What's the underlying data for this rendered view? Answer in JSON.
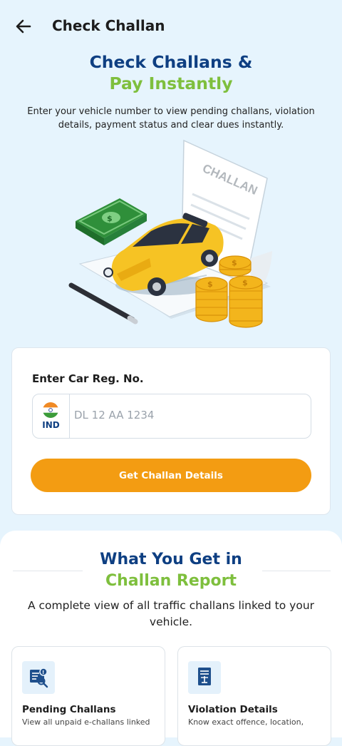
{
  "header": {
    "title": "Check Challan",
    "back_icon": "arrow-left-icon"
  },
  "hero": {
    "title_line1": "Check Challans &",
    "title_line2": "Pay Instantly",
    "description": "Enter your vehicle number to view pending challans, violation details, payment status and clear dues instantly.",
    "illustration_document_text": "CHALLAN"
  },
  "form": {
    "label": "Enter Car Reg. No.",
    "country_code": "IND",
    "flag_icon": "india-flag-icon",
    "placeholder": "DL 12 AA 1234",
    "value": "",
    "submit_label": "Get Challan Details"
  },
  "report": {
    "title_line1": "What You Get in",
    "title_line2": "Challan Report",
    "description": "A complete view of all traffic challans linked to your vehicle.",
    "features": [
      {
        "title": "Pending Challans",
        "desc": "View all unpaid e-challans linked",
        "icon": "pending-challan-icon"
      },
      {
        "title": "Violation Details",
        "desc": "Know exact offence, location,",
        "icon": "violation-document-icon"
      }
    ]
  },
  "colors": {
    "background": "#e6f4fd",
    "primary_blue": "#0e3f82",
    "accent_green": "#7ebf3d",
    "button_orange": "#f39c12"
  }
}
